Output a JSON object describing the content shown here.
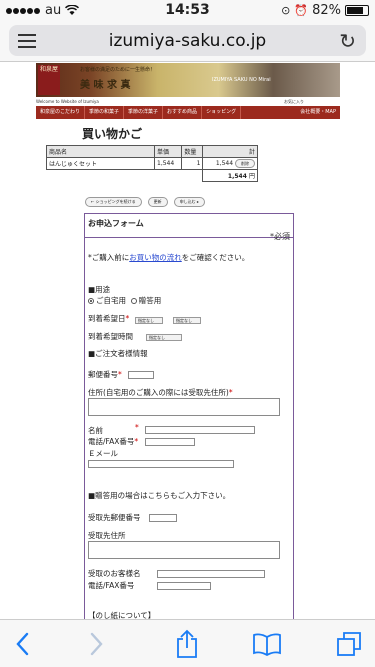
{
  "status": {
    "carrier": "au",
    "time": "14:53",
    "battery": "82%",
    "battery_level": 0.82
  },
  "browser": {
    "url": "izumiya-saku.co.jp"
  },
  "site": {
    "logo_text": "和泉屋",
    "tagline": "お客様の満足のために一生懸命！",
    "banner_title": "美 味 求 真",
    "banner_title2": "IZUMIYA SAKU NO Mirai",
    "welcome": "Welcome to Website of Izumiya",
    "favorites": "お気に入り",
    "nav": [
      "和泉屋のこだわり",
      "季節の和菓子",
      "季節の洋菓子",
      "おすすめ商品",
      "ショッピング",
      "会社概要・MAP"
    ]
  },
  "cart": {
    "title": "買い物かご",
    "headers": [
      "商品名",
      "単価",
      "数量",
      "計"
    ],
    "rows": [
      {
        "name": "はんじゅくセット",
        "price": "1,544",
        "qty": "1",
        "total": "1,544",
        "action": "削除"
      }
    ],
    "total": "1,544",
    "total_unit": "円",
    "buttons": [
      "← ショッピングを続ける",
      "更新",
      "申し込む ▸"
    ]
  },
  "form": {
    "title": "お申込フォーム",
    "required_note": "*必須",
    "intro_pre": "*ご購入前に",
    "intro_link": "お買い物の流れ",
    "intro_post": "をご確認ください。",
    "purpose_label": "■用途",
    "purpose_options": [
      "ご自宅用",
      "贈答用"
    ],
    "arrival_date": "到着希望日",
    "arrival_time": "到着希望時間",
    "select_placeholder": "指定なし",
    "orderer_header": "■ご注文者様情報",
    "zip": "郵便番号",
    "address": "住所(自宅用のご購入の際には受取先住所)",
    "name": "名前",
    "tel": "電話/FAX番号",
    "email": "Ｅメール",
    "gift_header": "■贈答用の場合はこちらもご入力下さい。",
    "recv_zip": "受取先郵便番号",
    "recv_address": "受取先住所",
    "recv_name": "受取のお客様名",
    "recv_tel": "電話/FAX番号",
    "noshi": "【のし紙について】",
    "asterisk": "*"
  }
}
